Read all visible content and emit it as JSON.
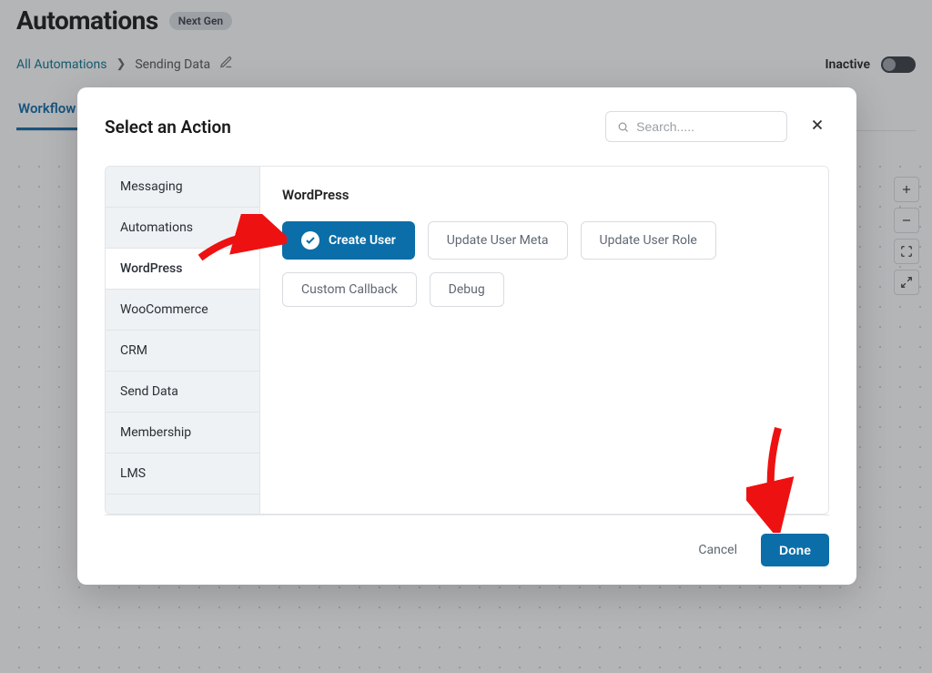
{
  "page": {
    "title": "Automations",
    "badge": "Next Gen"
  },
  "breadcrumb": {
    "root": "All Automations",
    "current": "Sending Data"
  },
  "status": {
    "label": "Inactive"
  },
  "tabs": {
    "workflow": "Workflow"
  },
  "modal": {
    "title": "Select an Action",
    "search_placeholder": "Search.....",
    "section_heading": "WordPress",
    "categories": [
      {
        "label": "Messaging"
      },
      {
        "label": "Automations"
      },
      {
        "label": "WordPress",
        "active": true
      },
      {
        "label": "WooCommerce"
      },
      {
        "label": "CRM"
      },
      {
        "label": "Send Data"
      },
      {
        "label": "Membership"
      },
      {
        "label": "LMS"
      }
    ],
    "actions": [
      {
        "label": "Create User",
        "selected": true
      },
      {
        "label": "Update User Meta"
      },
      {
        "label": "Update User Role"
      },
      {
        "label": "Custom Callback"
      },
      {
        "label": "Debug"
      }
    ],
    "cancel_label": "Cancel",
    "done_label": "Done"
  }
}
